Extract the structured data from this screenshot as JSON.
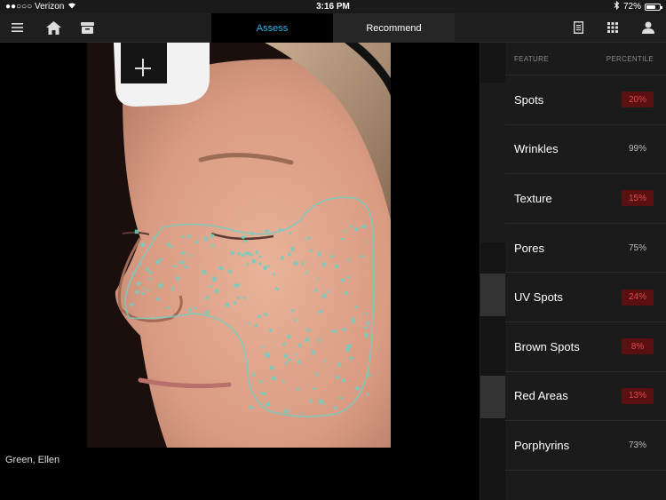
{
  "status": {
    "carrier": "●●○○○ Verizon",
    "time": "3:16 PM",
    "battery": "72%",
    "battery_fraction": 0.72
  },
  "toolbar": {
    "tabs": [
      {
        "label": "Assess",
        "active": true
      },
      {
        "label": "Recommend",
        "active": false
      }
    ]
  },
  "patient": {
    "name": "Green, Ellen"
  },
  "panel": {
    "header_feature": "FEATURE",
    "header_percentile": "PERCENTILE",
    "features": [
      {
        "label": "Spots",
        "value": "20%",
        "low": true
      },
      {
        "label": "Wrinkles",
        "value": "99%",
        "low": false
      },
      {
        "label": "Texture",
        "value": "15%",
        "low": true
      },
      {
        "label": "Pores",
        "value": "75%",
        "low": false
      },
      {
        "label": "UV Spots",
        "value": "24%",
        "low": true
      },
      {
        "label": "Brown Spots",
        "value": "8%",
        "low": true
      },
      {
        "label": "Red Areas",
        "value": "13%",
        "low": true
      },
      {
        "label": "Porphyrins",
        "value": "73%",
        "low": false
      }
    ]
  },
  "colors": {
    "accent": "#2fb4e9",
    "low_badge_bg": "#5a1010",
    "low_badge_text": "#e04a4a",
    "spot_overlay": "#6fd0c4"
  }
}
